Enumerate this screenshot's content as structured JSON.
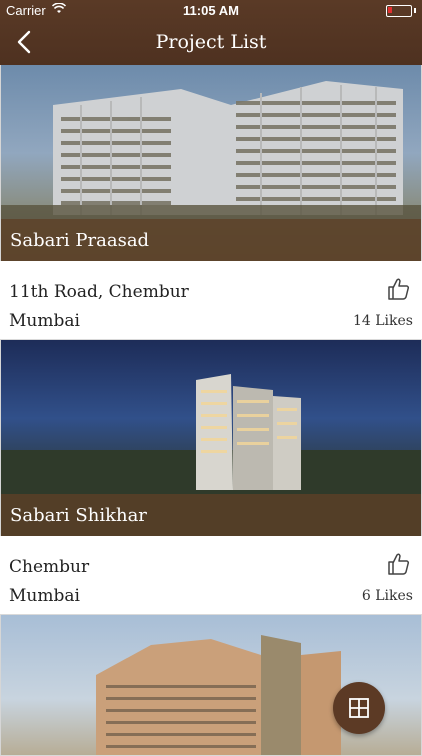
{
  "status_bar": {
    "carrier": "Carrier",
    "time": "11:05 AM",
    "battery_color": "#e23030"
  },
  "nav": {
    "title": "Project List",
    "back_icon": "chevron-left-icon"
  },
  "projects": [
    {
      "name": "Sabari Praasad",
      "location": "11th Road, Chembur",
      "city": "Mumbai",
      "likes": "14 Likes"
    },
    {
      "name": "Sabari Shikhar",
      "location": "Chembur",
      "city": "Mumbai",
      "likes": "6 Likes"
    },
    {
      "name": "",
      "location": "",
      "city": "",
      "likes": ""
    }
  ],
  "fab": {
    "icon": "grid-icon"
  },
  "colors": {
    "header_brown": "#4e3120",
    "caption_bar": "#5e4026",
    "fab_brown": "#5c3a25"
  }
}
